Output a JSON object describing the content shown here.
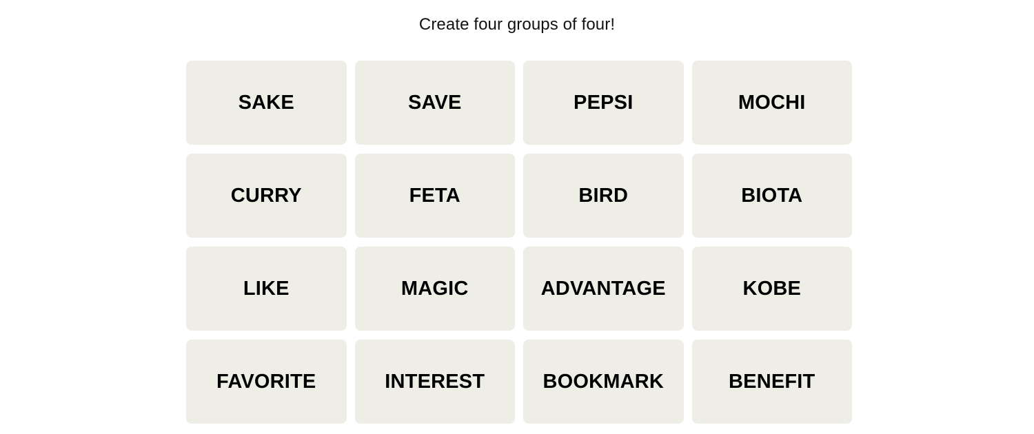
{
  "page": {
    "background_color": "#FFFFFF"
  },
  "instruction": {
    "text": "Create four groups of four!"
  },
  "board": {
    "columns": 4,
    "rows": 4,
    "tile_color": "#EFEEE6",
    "tile_text_color": "#000000",
    "tiles": [
      {
        "label": "SAKE"
      },
      {
        "label": "SAVE"
      },
      {
        "label": "PEPSI"
      },
      {
        "label": "MOCHI"
      },
      {
        "label": "CURRY"
      },
      {
        "label": "FETA"
      },
      {
        "label": "BIRD"
      },
      {
        "label": "BIOTA"
      },
      {
        "label": "LIKE"
      },
      {
        "label": "MAGIC"
      },
      {
        "label": "ADVANTAGE"
      },
      {
        "label": "KOBE"
      },
      {
        "label": "FAVORITE"
      },
      {
        "label": "INTEREST"
      },
      {
        "label": "BOOKMARK"
      },
      {
        "label": "BENEFIT"
      }
    ]
  }
}
